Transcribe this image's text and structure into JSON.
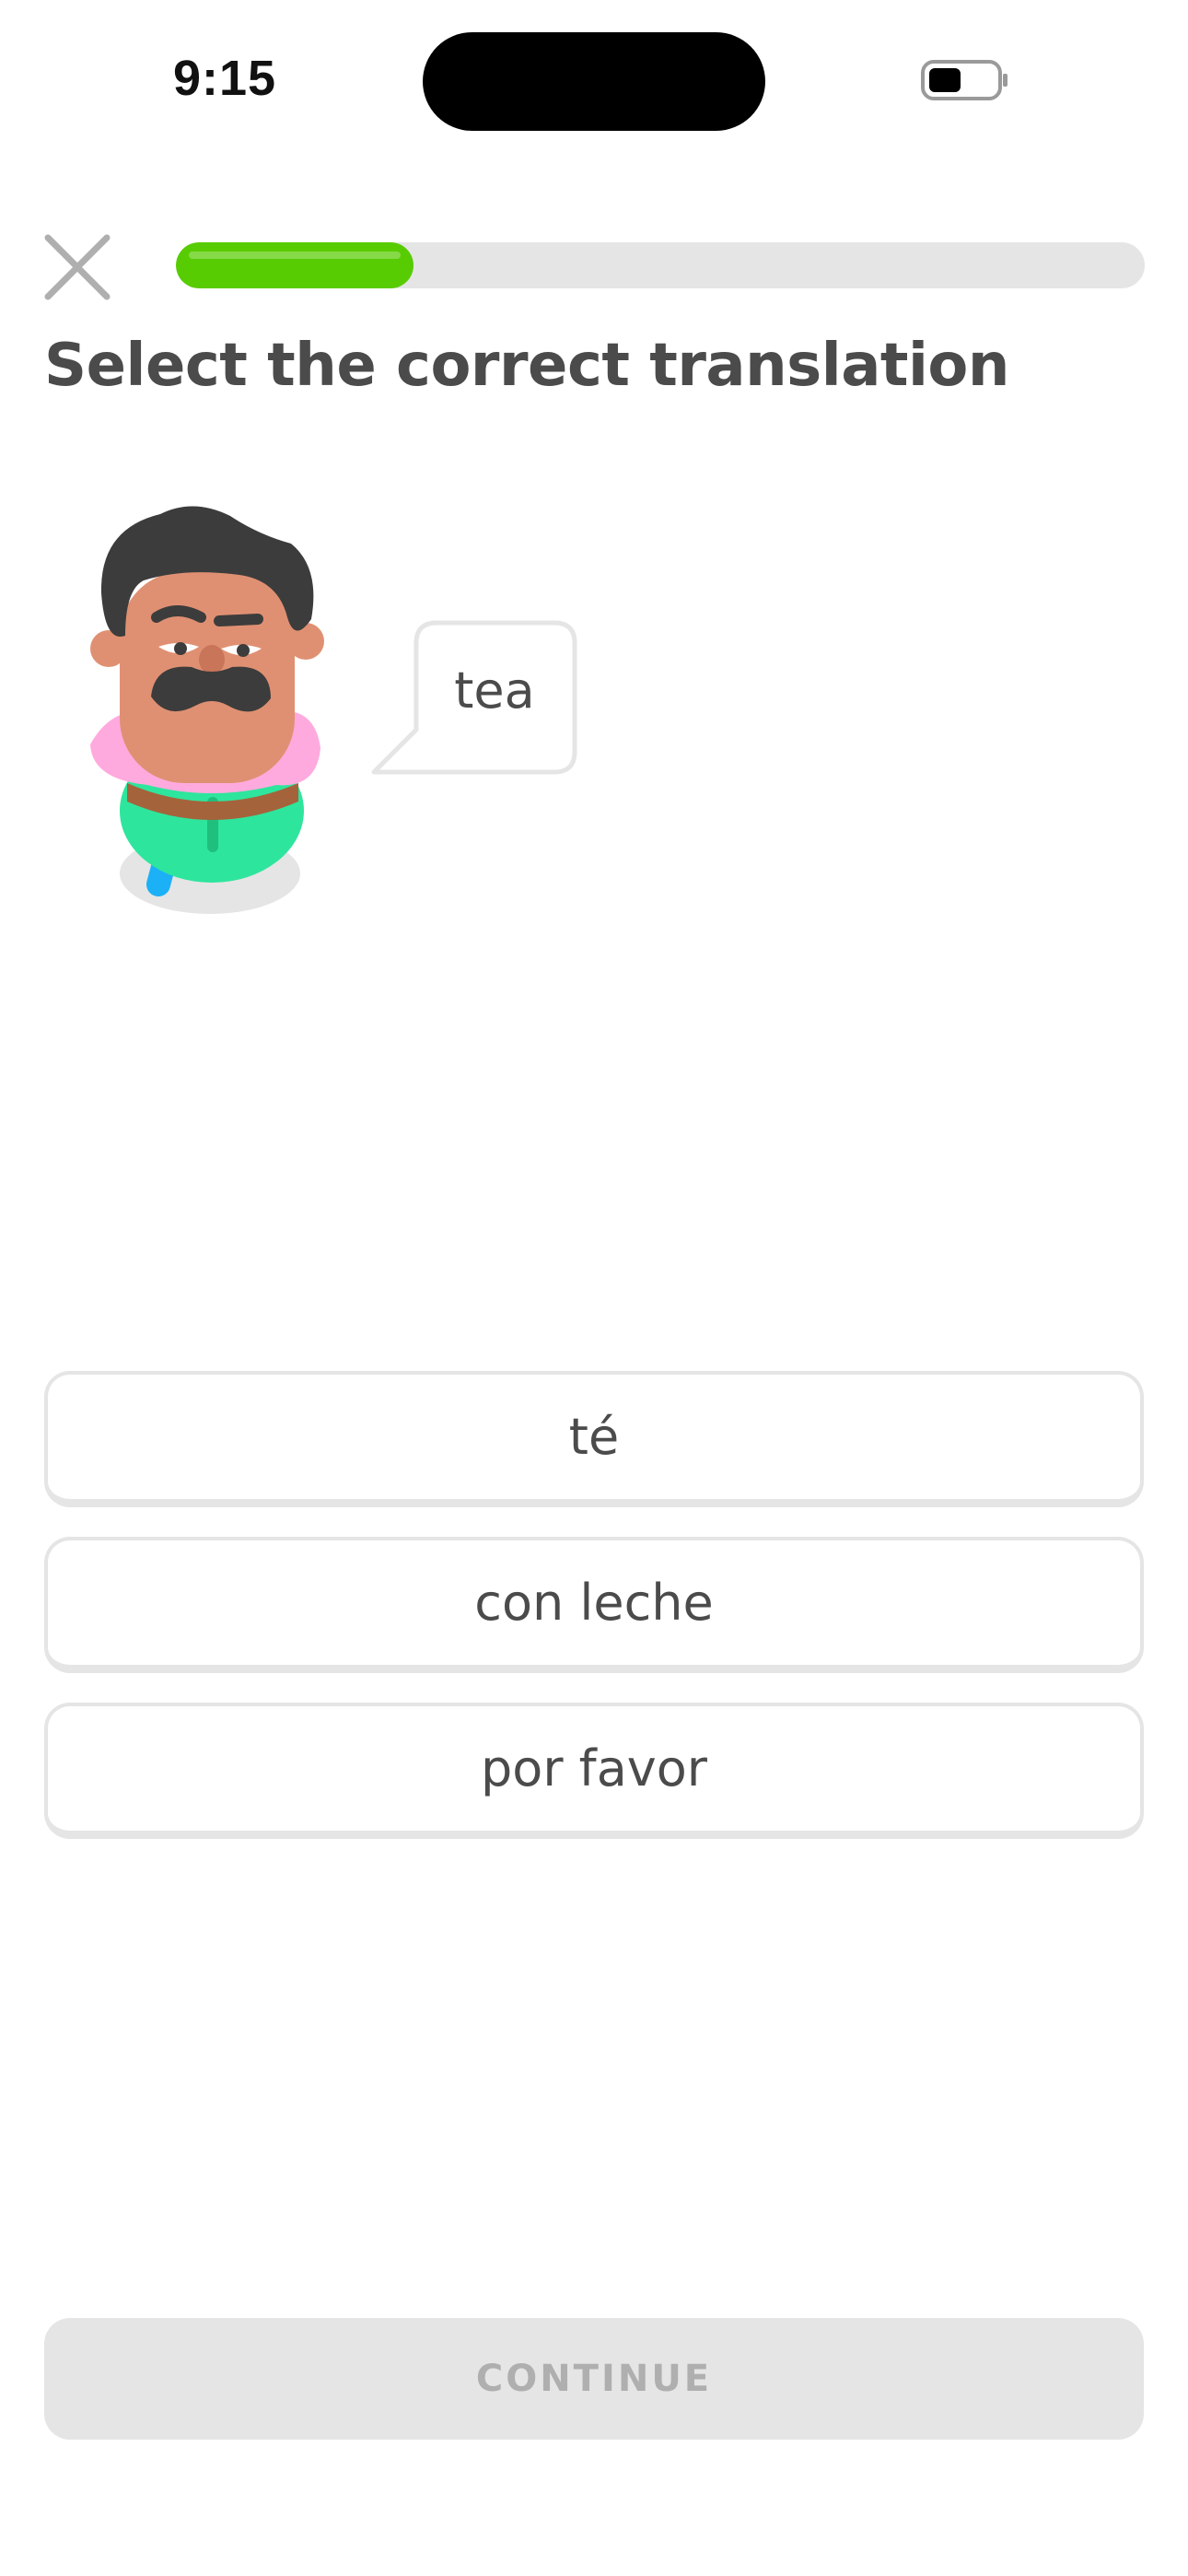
{
  "status_bar": {
    "time": "9:15",
    "battery_icon": "battery-icon"
  },
  "lesson_header": {
    "close_icon": "close-icon",
    "progress_fraction": 0.245,
    "progress_color": "#58cc02"
  },
  "prompt": {
    "title": "Select the correct translation",
    "character": "duo-character-mustache-man",
    "speech_word": "tea"
  },
  "choices": [
    {
      "label": "té"
    },
    {
      "label": "con leche"
    },
    {
      "label": "por favor"
    }
  ],
  "footer": {
    "continue_label": "CONTINUE"
  },
  "colors": {
    "text": "#4b4b4b",
    "border": "#e5e5e5",
    "disabled_text": "#afafaf",
    "accent_green": "#58cc02"
  }
}
